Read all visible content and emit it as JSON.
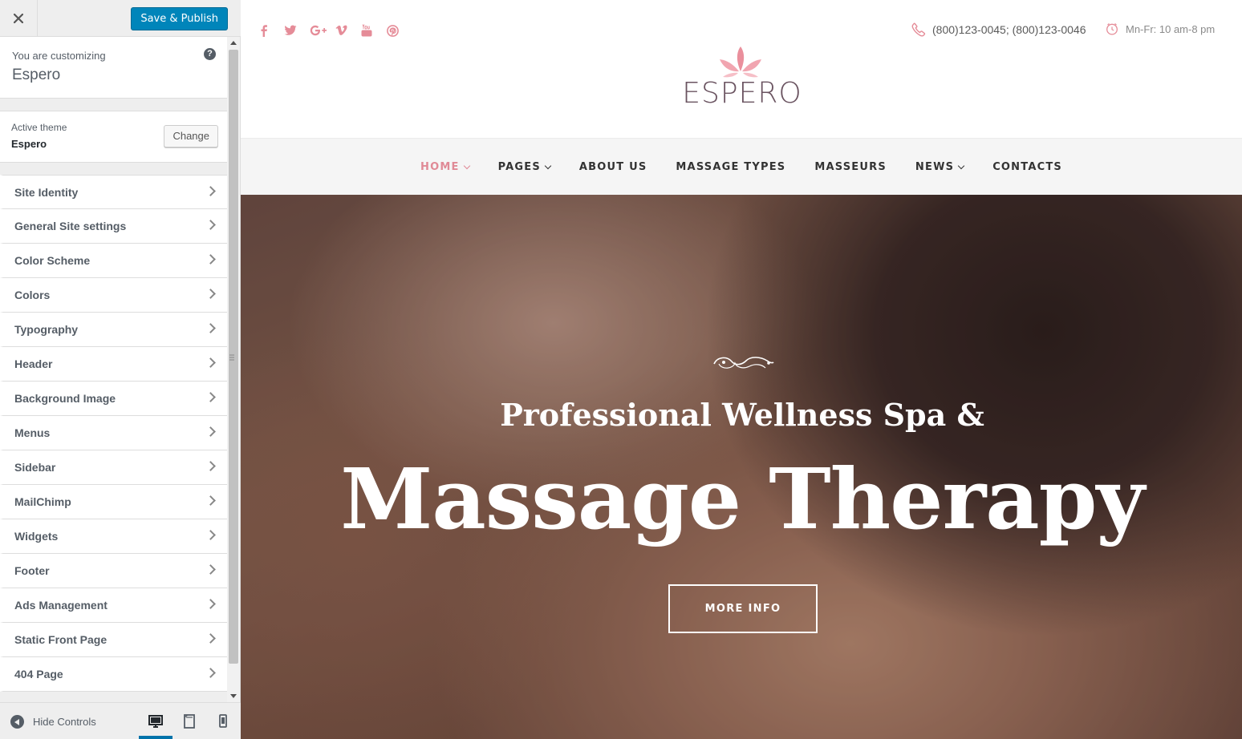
{
  "customizer": {
    "close_icon": "close-icon",
    "save_label": "Save & Publish",
    "info": {
      "label": "You are customizing",
      "title": "Espero",
      "help": "?"
    },
    "theme": {
      "label": "Active theme",
      "name": "Espero",
      "change_label": "Change"
    },
    "sections": [
      {
        "label": "Site Identity"
      },
      {
        "label": "General Site settings"
      },
      {
        "label": "Color Scheme"
      },
      {
        "label": "Colors"
      },
      {
        "label": "Typography"
      },
      {
        "label": "Header"
      },
      {
        "label": "Background Image"
      },
      {
        "label": "Menus"
      },
      {
        "label": "Sidebar"
      },
      {
        "label": "MailChimp"
      },
      {
        "label": "Widgets"
      },
      {
        "label": "Footer"
      },
      {
        "label": "Ads Management"
      },
      {
        "label": "Static Front Page"
      },
      {
        "label": "404 Page"
      }
    ],
    "footer": {
      "hide_label": "Hide Controls",
      "devices": [
        "desktop-icon",
        "tablet-icon",
        "mobile-icon"
      ],
      "active_device": "desktop"
    }
  },
  "site": {
    "accent_color": "#e08a96",
    "social_icons": [
      "facebook-icon",
      "twitter-icon",
      "google-plus-icon",
      "vimeo-icon",
      "youtube-icon",
      "pinterest-icon"
    ],
    "phone": "(800)123-0045; (800)123-0046",
    "hours": "Mn-Fr: 10 am-8 pm",
    "logo_text": "ESPERO",
    "nav": [
      {
        "label": "HOME",
        "has_dropdown": true,
        "active": true
      },
      {
        "label": "PAGES",
        "has_dropdown": true
      },
      {
        "label": "ABOUT US"
      },
      {
        "label": "MASSAGE TYPES"
      },
      {
        "label": "MASSEURS"
      },
      {
        "label": "NEWS",
        "has_dropdown": true
      },
      {
        "label": "CONTACTS"
      }
    ],
    "hero": {
      "subtitle": "Professional Wellness Spa &",
      "title": "Massage Therapy",
      "button": "MORE INFO"
    }
  }
}
